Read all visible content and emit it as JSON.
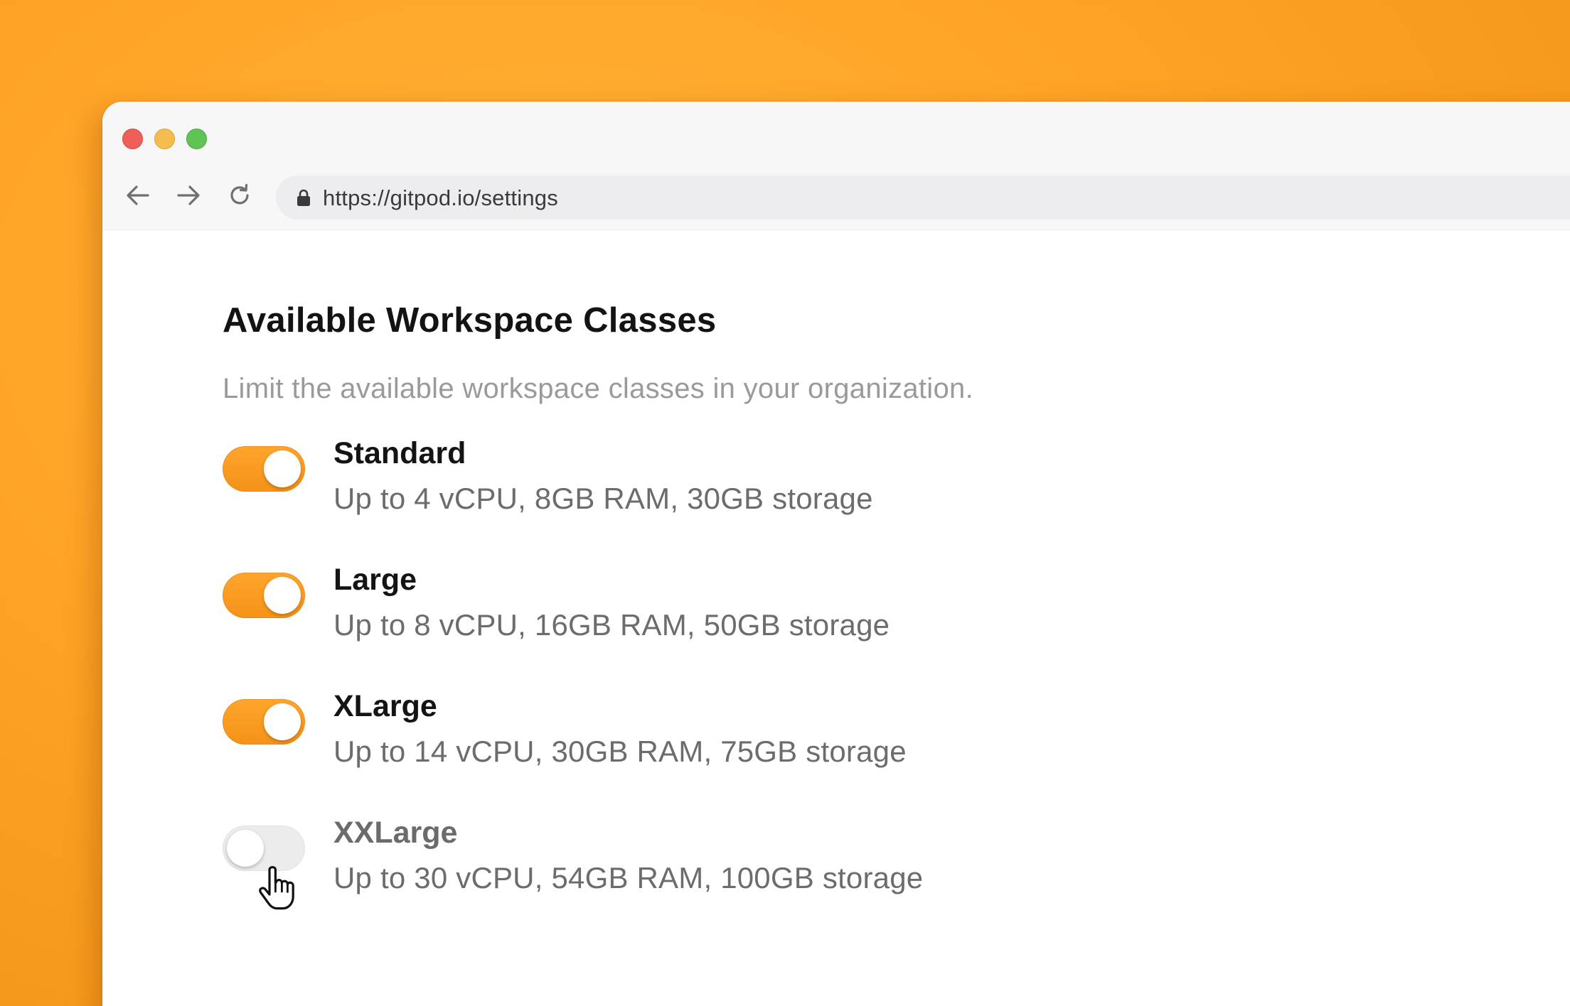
{
  "browser": {
    "url": "https://gitpod.io/settings",
    "icons": {
      "back": "arrow-left-icon",
      "forward": "arrow-right-icon",
      "reload": "reload-icon",
      "lock": "lock-icon"
    }
  },
  "settings": {
    "title": "Available Workspace Classes",
    "subtitle": "Limit the available workspace classes in your organization.",
    "accent_color": "#f59a23",
    "classes": [
      {
        "name": "Standard",
        "spec": "Up to 4 vCPU, 8GB RAM, 30GB storage",
        "enabled": true
      },
      {
        "name": "Large",
        "spec": "Up to 8 vCPU, 16GB RAM, 50GB storage",
        "enabled": true
      },
      {
        "name": "XLarge",
        "spec": "Up to 14 vCPU, 30GB RAM, 75GB storage",
        "enabled": true
      },
      {
        "name": "XXLarge",
        "spec": "Up to 30 vCPU, 54GB RAM, 100GB storage",
        "enabled": false
      }
    ]
  }
}
